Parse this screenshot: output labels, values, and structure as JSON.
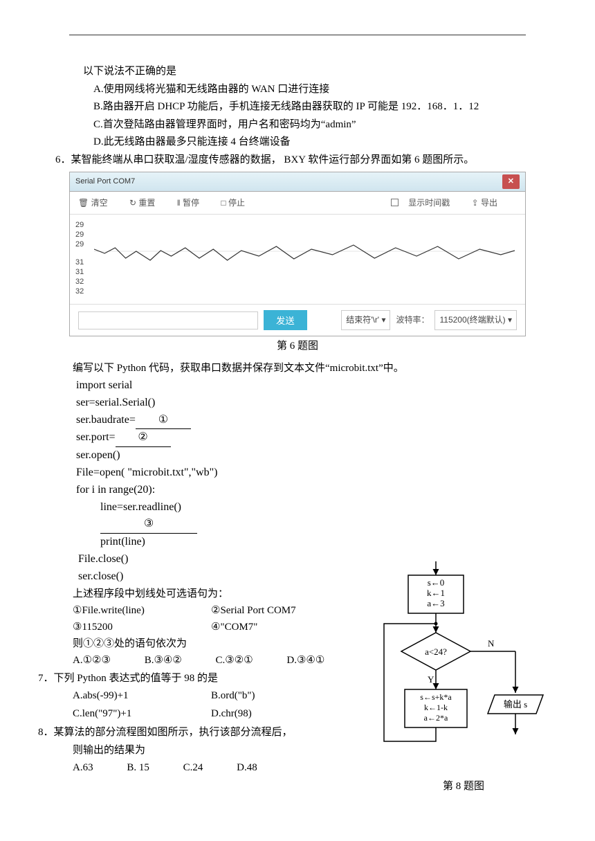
{
  "q5": {
    "stem_cont": "以下说法不正确的是",
    "A": "A.使用网线将光猫和无线路由器的  WAN 口进行连接",
    "B": "B.路由器开启  DHCP 功能后，手机连接无线路由器获取的  IP 可能是  192．168．1．12",
    "C": "C.首次登陆路由器管理界面时，用户名和密码均为“admin”",
    "D": "D.此无线路由器最多只能连接  4 台终端设备"
  },
  "q6": {
    "num": "6．",
    "stem": "某智能终端从串口获取温/湿度传感器的数据， BXY 软件运行部分界面如第  6 题图所示。",
    "window": {
      "title": "Serial Port COM7",
      "btn_clear": "清空",
      "btn_reset": "重置",
      "btn_pause": "暂停",
      "btn_stop": "停止",
      "chk_time": "显示时间戳",
      "btn_export": "导出",
      "y1a": "29",
      "y1b": "29",
      "y1c": "29",
      "y2a": "31",
      "y2b": "31",
      "y2c": "32",
      "y2d": "32",
      "btn_send": "发送",
      "jsf_lbl": "结束符'\\r'",
      "baud_lbl": "波特率：",
      "baud_val": "115200(终端默认)"
    },
    "caption": "第  6 题图",
    "para": "编写以下  Python 代码，获取串口数据并保存到文本文件“microbit.txt”中。",
    "code": {
      "l1": "import  serial",
      "l2": "ser=serial.Serial()",
      "l3a": "ser.baudrate=",
      "l3b": "①",
      "l4a": "ser.port=",
      "l4b": "②",
      "l5": "ser.open()",
      "l6": "File=open( \"microbit.txt\",\"wb\")",
      "l7": "for i in range(20):",
      "l8": "line=ser.readline()",
      "l9": "③",
      "l10": "print(line)",
      "l11": "File.close()",
      "l12": "ser.close()"
    },
    "choices_intro": "上述程序段中划线处可选语句为：",
    "c1": "①File.write(line)",
    "c2": "②Serial Port COM7",
    "c3": "③115200",
    "c4": "④\"COM7\"",
    "ask": "则①②③处的语句依次为",
    "A": "A.①②③",
    "B": "B.③④②",
    "C": "C.③②①",
    "D": "D.③④①"
  },
  "q7": {
    "num": "7．",
    "stem": "下列  Python 表达式的值等于  98 的是",
    "A": "A.abs(-99)+1",
    "B": "B.ord(\"b\")",
    "C": "C.len(\"97\")+1",
    "D": "D.chr(98)"
  },
  "q8": {
    "num": "8．",
    "stem1": "某算法的部分流程图如图所示，执行该部分流程后，",
    "stem2": "则输出的结果为",
    "A": "A.63",
    "B": "B. 15",
    "C": "C.24",
    "D": "D.48",
    "flowchart": {
      "init": "s←0\nk←1\na←3",
      "cond": "a<24?",
      "yes": "Y",
      "no": "N",
      "body": "s←s+k*a\nk←1-k\na←2*a",
      "out": "输出 s"
    },
    "caption": "第  8 题图"
  }
}
